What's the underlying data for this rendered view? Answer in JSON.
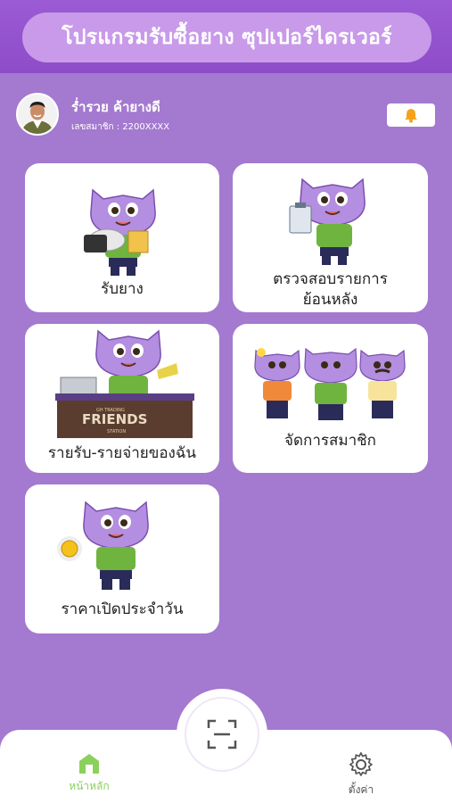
{
  "header": {
    "title": "โปรแกรมรับซื้อยาง ซุปเปอร์ไดรเวอร์"
  },
  "profile": {
    "name": "ร่ำรวย ค้ายางดี",
    "member_label": "เลขสมาชิก :",
    "member_id": "2200XXXX"
  },
  "notification": {
    "icon": "bell-icon"
  },
  "menu": {
    "items": [
      {
        "label": "รับยาง"
      },
      {
        "label_line1": "ตรวจสอบรายการ",
        "label_line2": "ย้อนหลัง"
      },
      {
        "label": "รายรับ-รายจ่ายของฉัน",
        "sign_brand": "FRIENDS",
        "sign_small": "GH TRADING",
        "sign_sub": "STATION"
      },
      {
        "label": "จัดการสมาชิก"
      },
      {
        "label": "ราคาเปิดประจำวัน"
      }
    ]
  },
  "bottom_nav": {
    "home": "หน้าหลัก",
    "scan_icon": "scan-icon",
    "settings": "ตั้งค่า"
  },
  "colors": {
    "background": "#a479d0",
    "header": "#8e4cc9",
    "title_pill": "#c89ae9",
    "active_nav": "#8ad15b",
    "bell": "#f6a21a",
    "mascot": "#b48ee0",
    "shirt": "#6fb43f"
  }
}
